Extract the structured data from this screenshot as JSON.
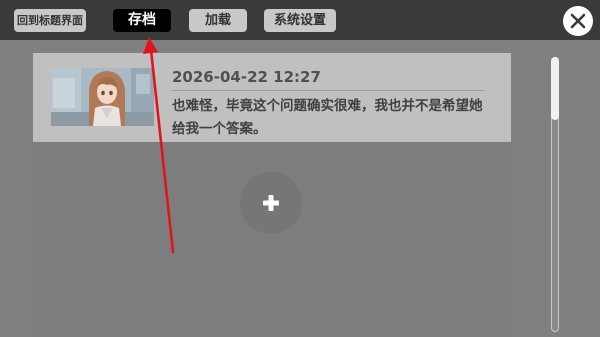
{
  "topbar": {
    "return_title_label": "回到标题界面",
    "save_label": "存档",
    "load_label": "加载",
    "settings_label": "系统设置",
    "active_tab": "存档"
  },
  "save_slots": [
    {
      "date": "2026-04-22  12:27",
      "text": "也难怪，毕竟这个问题确实很难，我也并不是希望她给我一个答案。"
    }
  ],
  "new_slot": {
    "icon": "plus-icon"
  },
  "close": {
    "icon": "close-icon"
  },
  "scroll": {
    "position_fraction": 0.0
  },
  "colors": {
    "background": "#808080",
    "topbar": "#3a3a3a",
    "tab_default": "#c8c8c8",
    "tab_active": "#000000",
    "slot_background": "#c0c0c0",
    "annotation_arrow": "#e0141e"
  }
}
